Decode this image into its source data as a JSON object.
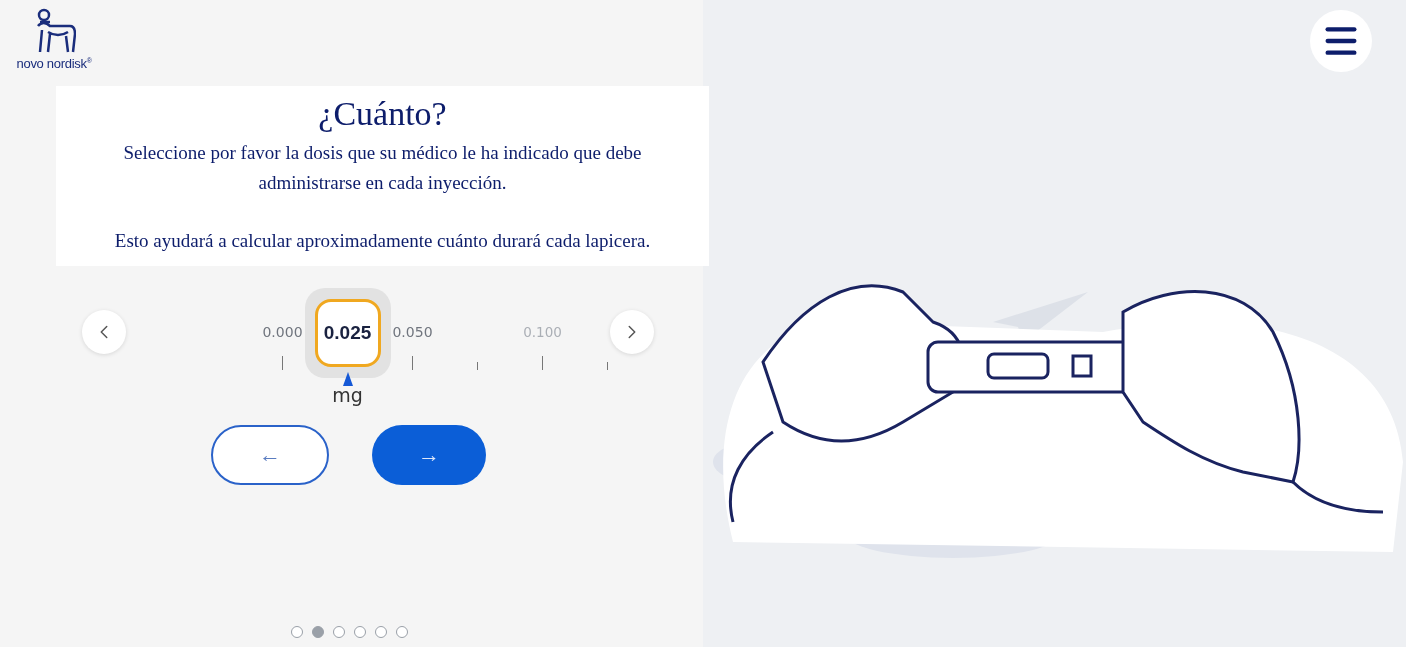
{
  "brand": {
    "name": "novo nordisk",
    "mark": "®"
  },
  "intro": {
    "title": "¿Cuánto?",
    "paragraphs": [
      "Seleccione por favor la dosis que su médico le ha indicado que debe administrarse en cada inyección.",
      "Esto ayudará a calcular aproximadamente cuánto durará cada lapicera."
    ]
  },
  "dose_scale": {
    "unit": "mg",
    "marks": [
      {
        "kind": "major",
        "label": "0.000",
        "selected": false
      },
      {
        "kind": "major",
        "label": "0.025",
        "selected": true
      },
      {
        "kind": "major",
        "label": "0.050",
        "selected": false
      },
      {
        "kind": "minor"
      },
      {
        "kind": "major",
        "label": "0.100",
        "selected": false,
        "faded": true
      },
      {
        "kind": "minor"
      }
    ]
  },
  "navigation": {
    "back": "←",
    "next": "→"
  },
  "steps": [
    {
      "selected": false
    },
    {
      "selected": true
    },
    {
      "selected": false
    },
    {
      "selected": false
    },
    {
      "selected": false
    },
    {
      "selected": false
    }
  ]
}
